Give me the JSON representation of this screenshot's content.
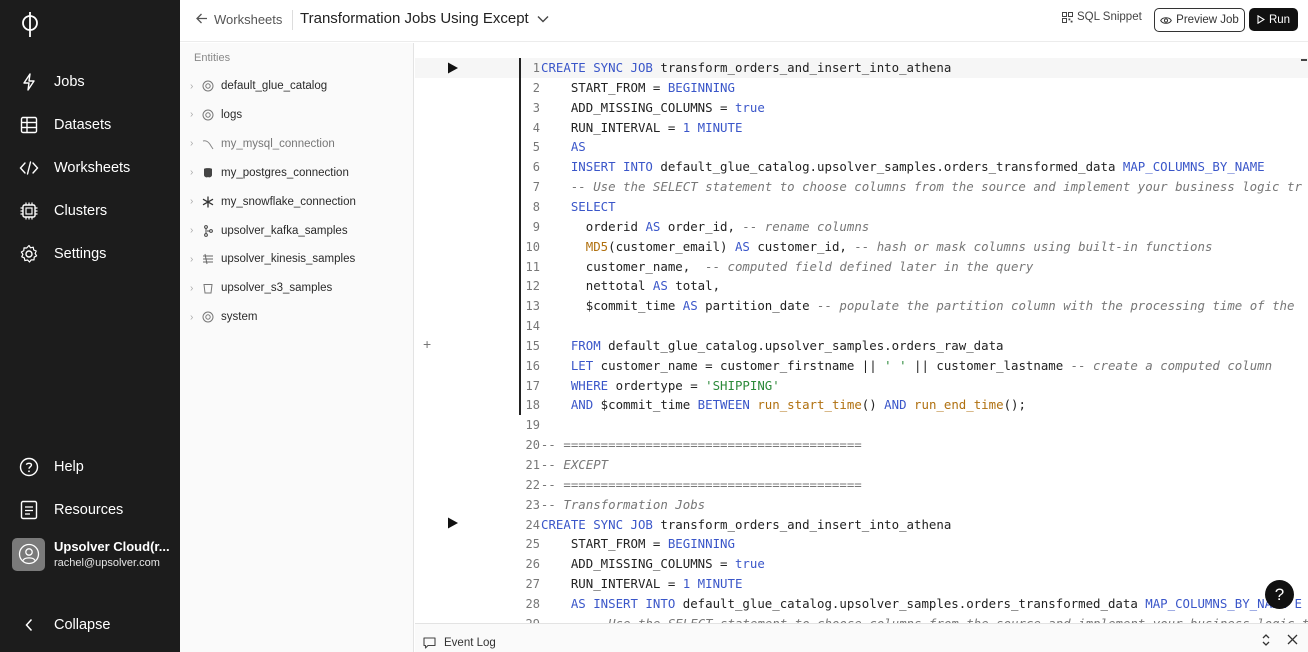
{
  "nav": {
    "items": [
      {
        "label": "Jobs",
        "icon": "bolt-icon"
      },
      {
        "label": "Datasets",
        "icon": "table-icon"
      },
      {
        "label": "Worksheets",
        "icon": "code-icon"
      },
      {
        "label": "Clusters",
        "icon": "chip-icon"
      },
      {
        "label": "Settings",
        "icon": "gear-icon"
      }
    ],
    "help": "Help",
    "resources": "Resources",
    "user_name": "Upsolver Cloud(r...",
    "user_email": "rachel@upsolver.com",
    "collapse": "Collapse"
  },
  "header": {
    "back_label": "Worksheets",
    "title": "Transformation Jobs Using Except",
    "sql_snippet": "SQL Snippet",
    "preview_job": "Preview Job",
    "run": "Run"
  },
  "entities": {
    "heading": "Entities",
    "items": [
      {
        "label": "default_glue_catalog",
        "icon": "catalog-icon"
      },
      {
        "label": "logs",
        "icon": "catalog-icon"
      },
      {
        "label": "my_mysql_connection",
        "icon": "mysql-icon"
      },
      {
        "label": "my_postgres_connection",
        "icon": "postgres-icon"
      },
      {
        "label": "my_snowflake_connection",
        "icon": "snowflake-icon"
      },
      {
        "label": "upsolver_kafka_samples",
        "icon": "kafka-icon"
      },
      {
        "label": "upsolver_kinesis_samples",
        "icon": "kinesis-icon"
      },
      {
        "label": "upsolver_s3_samples",
        "icon": "s3-bucket-icon"
      },
      {
        "label": "system",
        "icon": "catalog-icon"
      }
    ]
  },
  "editor": {
    "lines": [
      {
        "n": "1",
        "tokens": [
          [
            "kw",
            "CREATE SYNC JOB"
          ],
          [
            "",
            " transform_orders_and_insert_into_athena"
          ]
        ]
      },
      {
        "n": "2",
        "tokens": [
          [
            "",
            "    START_FROM = "
          ],
          [
            "kw",
            "BEGINNING"
          ]
        ]
      },
      {
        "n": "3",
        "tokens": [
          [
            "",
            "    ADD_MISSING_COLUMNS = "
          ],
          [
            "kw",
            "true"
          ]
        ]
      },
      {
        "n": "4",
        "tokens": [
          [
            "",
            "    RUN_INTERVAL = "
          ],
          [
            "kw",
            "1 MINUTE"
          ]
        ]
      },
      {
        "n": "5",
        "tokens": [
          [
            "kw",
            "    AS"
          ]
        ]
      },
      {
        "n": "6",
        "tokens": [
          [
            "kw",
            "    INSERT INTO"
          ],
          [
            "",
            " default_glue_catalog.upsolver_samples.orders_transformed_data "
          ],
          [
            "kw",
            "MAP_COLUMNS_BY_NAME"
          ]
        ]
      },
      {
        "n": "7",
        "tokens": [
          [
            "cm",
            "    -- Use the SELECT statement to choose columns from the source and implement your business logic tr"
          ]
        ]
      },
      {
        "n": "8",
        "tokens": [
          [
            "kw",
            "    SELECT"
          ]
        ]
      },
      {
        "n": "9",
        "tokens": [
          [
            "",
            "      orderid "
          ],
          [
            "kw",
            "AS"
          ],
          [
            "",
            " order_id, "
          ],
          [
            "cm",
            "-- rename columns"
          ]
        ]
      },
      {
        "n": "10",
        "tokens": [
          [
            "fn",
            "      MD5"
          ],
          [
            "",
            "(customer_email) "
          ],
          [
            "kw",
            "AS"
          ],
          [
            "",
            " customer_id, "
          ],
          [
            "cm",
            "-- hash or mask columns using built-in functions"
          ]
        ]
      },
      {
        "n": "11",
        "tokens": [
          [
            "",
            "      customer_name,  "
          ],
          [
            "cm",
            "-- computed field defined later in the query"
          ]
        ]
      },
      {
        "n": "12",
        "tokens": [
          [
            "",
            "      nettotal "
          ],
          [
            "kw",
            "AS"
          ],
          [
            "",
            " total,"
          ]
        ]
      },
      {
        "n": "13",
        "tokens": [
          [
            "",
            "      $commit_time "
          ],
          [
            "kw",
            "AS"
          ],
          [
            "",
            " partition_date "
          ],
          [
            "cm",
            "-- populate the partition column with the processing time of the"
          ]
        ]
      },
      {
        "n": "14",
        "tokens": []
      },
      {
        "n": "15",
        "tokens": [
          [
            "kw",
            "    FROM"
          ],
          [
            "",
            " default_glue_catalog.upsolver_samples.orders_raw_data"
          ]
        ]
      },
      {
        "n": "16",
        "tokens": [
          [
            "kw",
            "    LET"
          ],
          [
            "",
            " customer_name = customer_firstname || "
          ],
          [
            "str",
            "' '"
          ],
          [
            "",
            " || customer_lastname "
          ],
          [
            "cm",
            "-- create a computed column"
          ]
        ]
      },
      {
        "n": "17",
        "tokens": [
          [
            "kw",
            "    WHERE"
          ],
          [
            "",
            " ordertype = "
          ],
          [
            "str",
            "'SHIPPING'"
          ]
        ]
      },
      {
        "n": "18",
        "tokens": [
          [
            "kw",
            "    AND"
          ],
          [
            "",
            " $commit_time "
          ],
          [
            "kw",
            "BETWEEN"
          ],
          [
            "",
            " "
          ],
          [
            "fn",
            "run_start_time"
          ],
          [
            "",
            "() "
          ],
          [
            "kw",
            "AND"
          ],
          [
            "",
            " "
          ],
          [
            "fn",
            "run_end_time"
          ],
          [
            "",
            "();"
          ]
        ]
      },
      {
        "n": "19",
        "tokens": []
      },
      {
        "n": "20",
        "tokens": [
          [
            "cm",
            "-- ========================================"
          ]
        ]
      },
      {
        "n": "21",
        "tokens": [
          [
            "cm",
            "-- EXCEPT"
          ]
        ]
      },
      {
        "n": "22",
        "tokens": [
          [
            "cm",
            "-- ========================================"
          ]
        ]
      },
      {
        "n": "23",
        "tokens": [
          [
            "cm",
            "-- Transformation Jobs"
          ]
        ]
      },
      {
        "n": "24",
        "tokens": [
          [
            "kw",
            "CREATE SYNC JOB"
          ],
          [
            "",
            " transform_orders_and_insert_into_athena"
          ]
        ]
      },
      {
        "n": "25",
        "tokens": [
          [
            "",
            "    START_FROM = "
          ],
          [
            "kw",
            "BEGINNING"
          ]
        ]
      },
      {
        "n": "26",
        "tokens": [
          [
            "",
            "    ADD_MISSING_COLUMNS = "
          ],
          [
            "kw",
            "true"
          ]
        ]
      },
      {
        "n": "27",
        "tokens": [
          [
            "",
            "    RUN_INTERVAL = "
          ],
          [
            "kw",
            "1 MINUTE"
          ]
        ]
      },
      {
        "n": "28",
        "tokens": [
          [
            "kw",
            "    AS INSERT INTO"
          ],
          [
            "",
            " default_glue_catalog.upsolver_samples.orders_transformed_data "
          ],
          [
            "kw",
            "MAP_COLUMNS_BY_NAME E"
          ]
        ]
      },
      {
        "n": "29",
        "tokens": [
          [
            "cm",
            "      -- Use the SELECT statement to choose columns from the source and implement your business logic tr"
          ]
        ]
      }
    ]
  },
  "footer": {
    "event_log": "Event Log",
    "help_fab": "?"
  }
}
